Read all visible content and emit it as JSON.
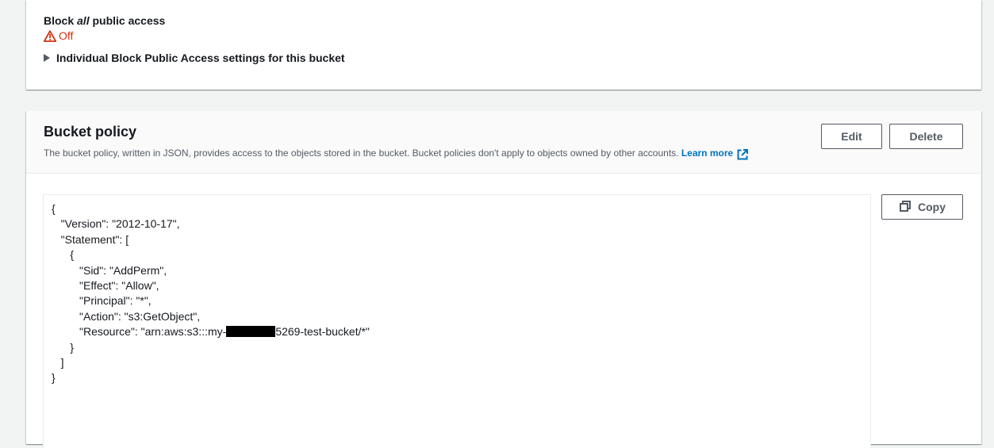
{
  "block_public_access": {
    "label_prefix": "Block ",
    "label_emphasis": "all",
    "label_suffix": " public access",
    "status": "Off",
    "status_icon": "warning-triangle-icon",
    "status_color": "#d13212",
    "expander_label": "Individual Block Public Access settings for this bucket"
  },
  "bucket_policy": {
    "title": "Bucket policy",
    "description": "The bucket policy, written in JSON, provides access to the objects stored in the bucket. Bucket policies don't apply to objects owned by other accounts. ",
    "learn_more": "Learn more",
    "edit_label": "Edit",
    "delete_label": "Delete",
    "copy_label": "Copy",
    "copy_icon": "copy-icon",
    "external_link_icon": "external-link-icon",
    "accent_color": "#0073bb",
    "code_before_redaction": "{\n   \"Version\": \"2012-10-17\",\n   \"Statement\": [\n      {\n         \"Sid\": \"AddPerm\",\n         \"Effect\": \"Allow\",\n         \"Principal\": \"*\",\n         \"Action\": \"s3:GetObject\",\n         \"Resource\": \"arn:aws:s3:::my-",
    "code_after_redaction": "5269-test-bucket/*\"\n      }\n   ]\n}"
  }
}
